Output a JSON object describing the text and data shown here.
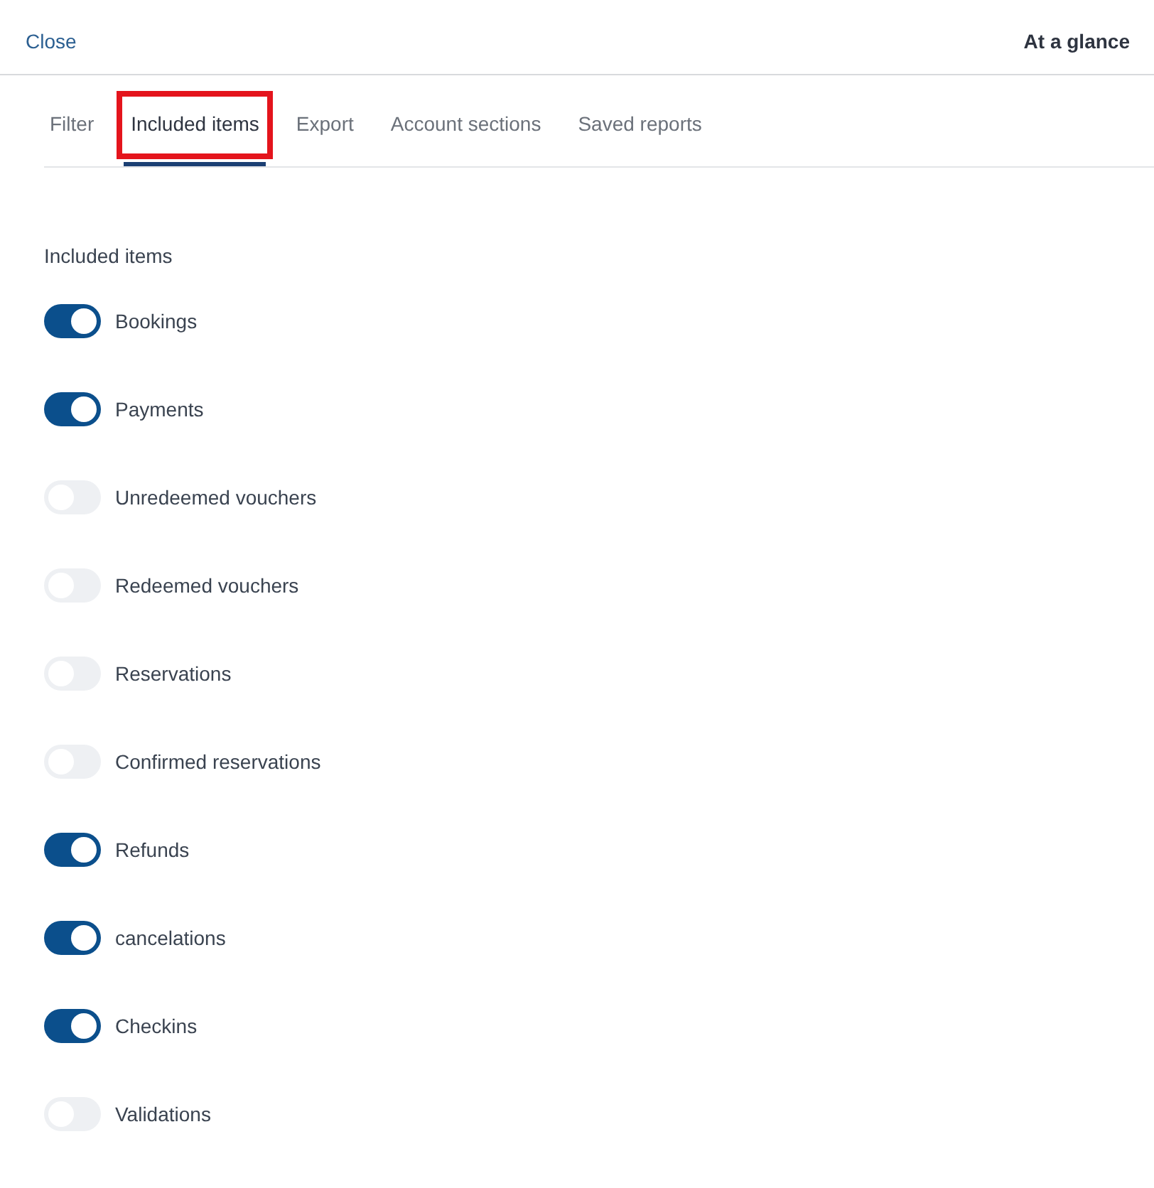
{
  "header": {
    "close": "Close",
    "title": "At a glance"
  },
  "tabs": [
    {
      "label": "Filter",
      "selected": false,
      "highlighted": false
    },
    {
      "label": "Included items",
      "selected": true,
      "highlighted": true
    },
    {
      "label": "Export",
      "selected": false,
      "highlighted": false
    },
    {
      "label": "Account sections",
      "selected": false,
      "highlighted": false
    },
    {
      "label": "Saved reports",
      "selected": false,
      "highlighted": false
    }
  ],
  "section_title": "Included items",
  "items": [
    {
      "label": "Bookings",
      "on": true
    },
    {
      "label": "Payments",
      "on": true
    },
    {
      "label": "Unredeemed vouchers",
      "on": false
    },
    {
      "label": "Redeemed vouchers",
      "on": false
    },
    {
      "label": "Reservations",
      "on": false
    },
    {
      "label": "Confirmed reservations",
      "on": false
    },
    {
      "label": "Refunds",
      "on": true
    },
    {
      "label": "cancelations",
      "on": true
    },
    {
      "label": "Checkins",
      "on": true
    },
    {
      "label": "Validations",
      "on": false
    }
  ]
}
